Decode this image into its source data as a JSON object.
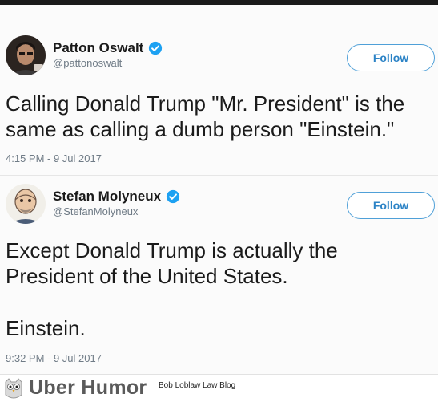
{
  "tweets": [
    {
      "display_name": "Patton Oswalt",
      "handle": "@pattonoswalt",
      "follow_label": "Follow",
      "text_lines": [
        "Calling Donald Trump \"Mr. President\" is the",
        "same as calling a dumb person \"Einstein.\""
      ],
      "timestamp": "4:15 PM - 9 Jul 2017"
    },
    {
      "display_name": "Stefan Molyneux",
      "handle": "@StefanMolyneux",
      "follow_label": "Follow",
      "text_lines": [
        "Except Donald Trump is actually the",
        "President of the United States.",
        "Einstein."
      ],
      "timestamp": "9:32 PM - 9 Jul 2017"
    }
  ],
  "footer": {
    "brand": "Uber Humor",
    "blog": "Bob Loblaw Law Blog"
  },
  "colors": {
    "verified": "#1da1f2",
    "follow_border": "#4fa0d8",
    "follow_text": "#2c83c6",
    "meta_text": "#6f7b86"
  },
  "icons": {
    "verified": "verified-badge-icon",
    "footer_logo": "owl-icon"
  }
}
